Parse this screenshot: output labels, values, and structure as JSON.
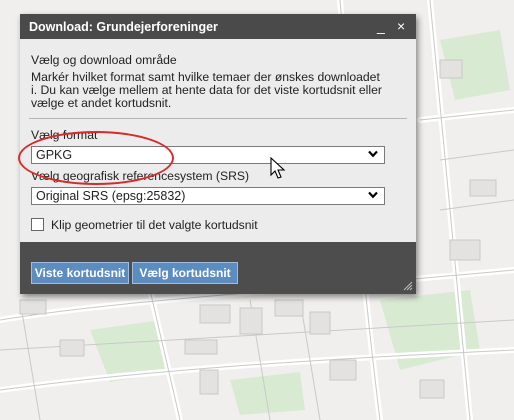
{
  "dialog": {
    "title": "Download: Grundejerforeninger",
    "minimize_label": "_",
    "close_label": "×",
    "heading": "Vælg og download område",
    "description_lines": [
      "Markér hvilket format samt hvilke temaer der ønskes downloadet",
      "i. Du kan vælge mellem at hente data for det viste kortudsnit eller",
      "vælge et andet kortudsnit."
    ],
    "format": {
      "label": "Vælg format",
      "value": "GPKG"
    },
    "srs": {
      "label": "Vælg geografisk referencesystem (SRS)",
      "value": "Original SRS (epsg:25832)"
    },
    "clip": {
      "label": "Klip geometrier til det valgte kortudsnit",
      "checked": false
    },
    "buttons": {
      "current_extent": "Viste kortudsnit",
      "choose_extent": "Vælg kortudsnit"
    }
  },
  "colors": {
    "titlebar": "#4a4a4a",
    "panel": "#ececec",
    "footer": "#4d4d4d",
    "button": "#5c8cc0",
    "highlight_ellipse": "#d82a2a",
    "map_background": "#f0efed",
    "map_green": "#d8ebd2"
  }
}
